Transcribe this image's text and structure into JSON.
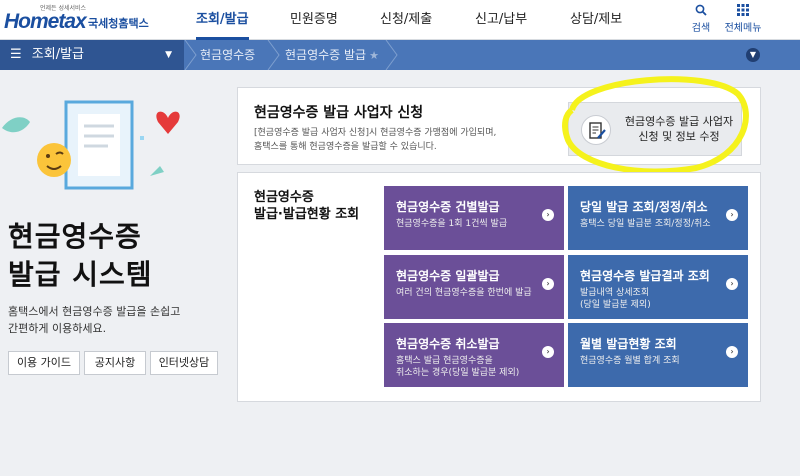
{
  "header": {
    "logo_tagline": "언제든 성세서비스",
    "logo_main": "Hometax",
    "logo_sub": "국세청홈택스",
    "nav": [
      "조회/발급",
      "민원증명",
      "신청/제출",
      "신고/납부",
      "상담/제보"
    ],
    "search_label": "검색",
    "menu_label": "전체메뉴"
  },
  "navbar": {
    "section": "조회/발급",
    "breadcrumbs": [
      "현금영수증",
      "현금영수증 발급"
    ]
  },
  "hero": {
    "title_line1": "현금영수증",
    "title_line2": "발급 시스템",
    "desc_line1": "홈택스에서 현금영수증 발급을 손쉽고",
    "desc_line2": "간편하게 이용하세요.",
    "buttons": [
      "이용 가이드",
      "공지사항",
      "인터넷상담"
    ]
  },
  "apply_panel": {
    "title": "현금영수증 발급 사업자 신청",
    "desc_line1": "[현금영수증 발급 사업자 신청]시 현금영수증 가맹점에 가입되며,",
    "desc_line2": "홈택스를 통해 현금영수증을 발급할 수 있습니다.",
    "button_line1": "현금영수증 발급 사업자",
    "button_line2": "신청 및 정보 수정"
  },
  "issue_panel": {
    "title_line1": "현금영수증",
    "title_line2": "발급·발급현황 조회",
    "tiles": [
      {
        "title": "현금영수증 건별발급",
        "desc_line1": "현금영수증을 1회 1건씩 발급",
        "desc_line2": ""
      },
      {
        "title": "당일 발급 조회/정정/취소",
        "desc_line1": "홈택스 당일 발급분 조회/정정/취소",
        "desc_line2": ""
      },
      {
        "title": "현금영수증 일괄발급",
        "desc_line1": "여러 건의 현금영수증을 한번에 발급",
        "desc_line2": ""
      },
      {
        "title": "현금영수증 발급결과 조회",
        "desc_line1": "발급내역 상세조회",
        "desc_line2": "(당일 발급분 제외)"
      },
      {
        "title": "현금영수증 취소발급",
        "desc_line1": "홈택스 발급 현금영수증을",
        "desc_line2": "취소하는 경우(당일 발급분 제외)"
      },
      {
        "title": "월별 발급현황 조회",
        "desc_line1": "현금영수증 월별 합계 조회",
        "desc_line2": ""
      }
    ]
  },
  "colors": {
    "brand_blue": "#1b4fa0",
    "nav_blue": "#4a76b8",
    "tile_purple": "#6b4f98",
    "tile_blue": "#3d6aac",
    "highlight": "#f5f21c"
  }
}
